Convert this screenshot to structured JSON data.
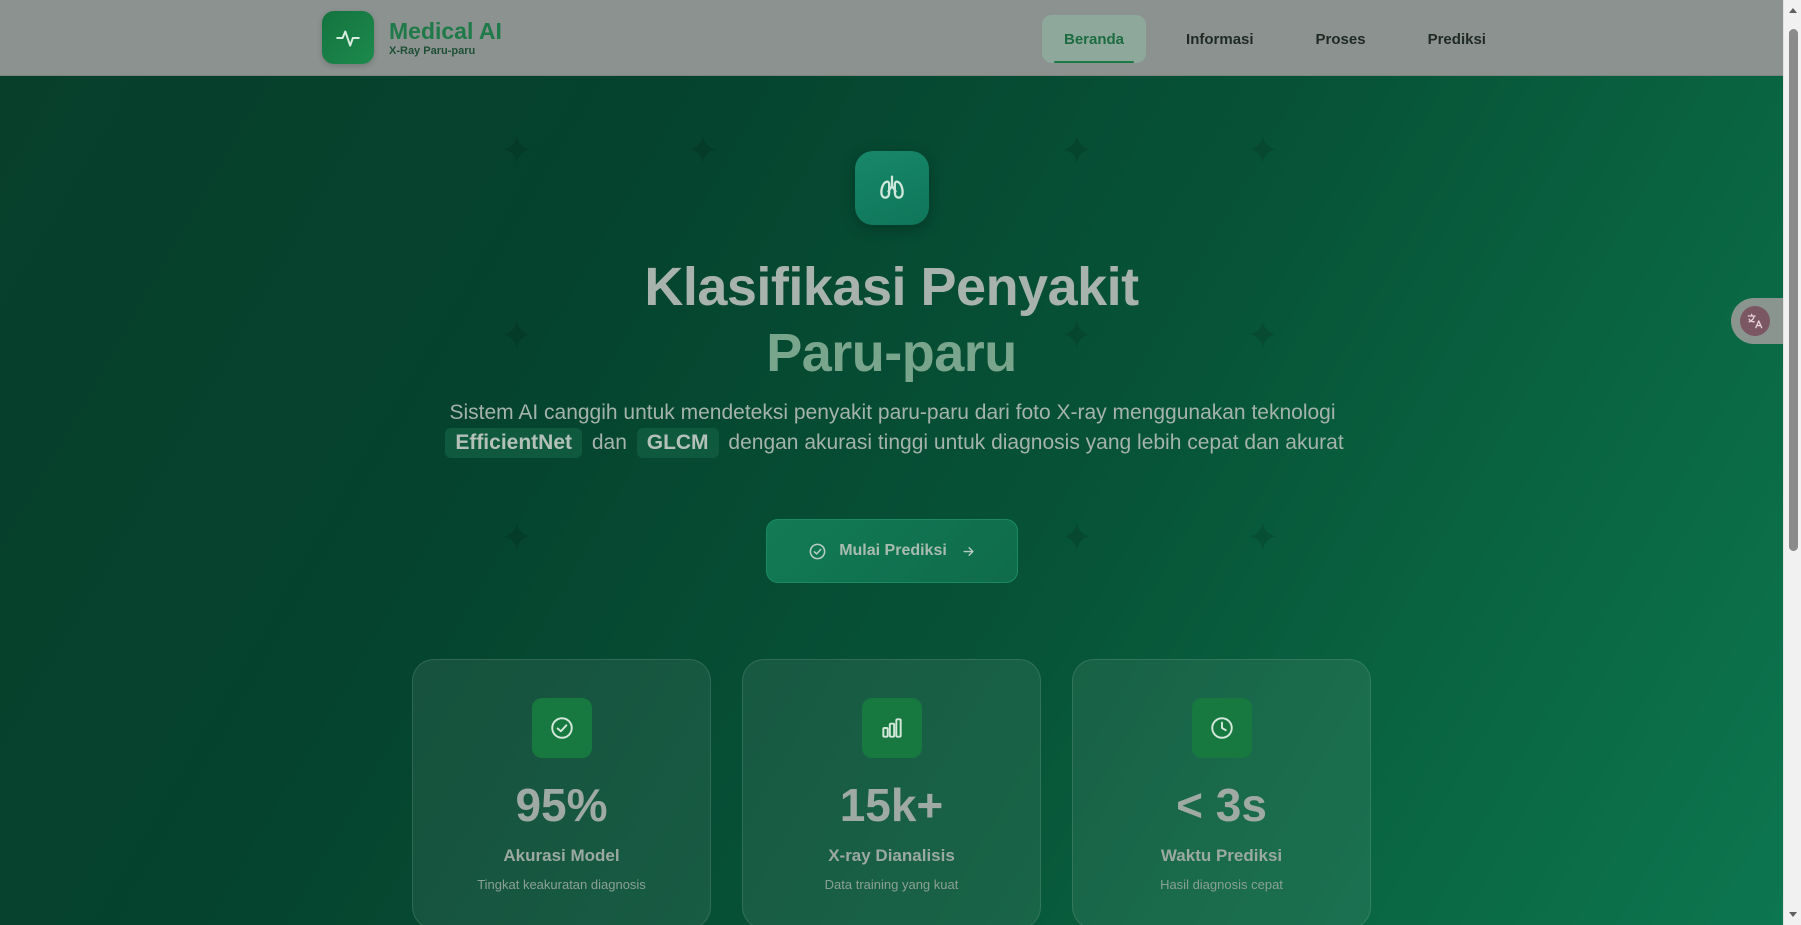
{
  "brand": {
    "title": "Medical AI",
    "subtitle": "X-Ray Paru-paru",
    "logo_icon": "heartbeat-icon"
  },
  "nav": {
    "items": [
      {
        "label": "Beranda",
        "active": true
      },
      {
        "label": "Informasi",
        "active": false
      },
      {
        "label": "Proses",
        "active": false
      },
      {
        "label": "Prediksi",
        "active": false
      }
    ]
  },
  "hero": {
    "icon": "lungs-icon",
    "title_line1": "Klasifikasi Penyakit",
    "title_line2": "Paru-paru",
    "desc_part1": "Sistem AI canggih untuk mendeteksi penyakit paru-paru dari foto X-ray menggunakan teknologi",
    "highlight1": "EfficientNet",
    "desc_part2": "dan",
    "highlight2": "GLCM",
    "desc_part3": "dengan akurasi tinggi untuk diagnosis yang lebih cepat dan akurat",
    "cta_label": "Mulai Prediksi"
  },
  "stats": [
    {
      "icon": "check-circle-icon",
      "value": "95%",
      "label": "Akurasi Model",
      "sub": "Tingkat keakuratan diagnosis"
    },
    {
      "icon": "bar-chart-icon",
      "value": "15k+",
      "label": "X-ray Dianalisis",
      "sub": "Data training yang kuat"
    },
    {
      "icon": "clock-icon",
      "value": "< 3s",
      "label": "Waktu Prediksi",
      "sub": "Hasil diagnosis cepat"
    }
  ],
  "colors": {
    "brand_green": "#1f7a49",
    "header_bg": "#8c928f",
    "hero_bg_start": "#073f2b",
    "hero_bg_end": "#0c7650"
  }
}
